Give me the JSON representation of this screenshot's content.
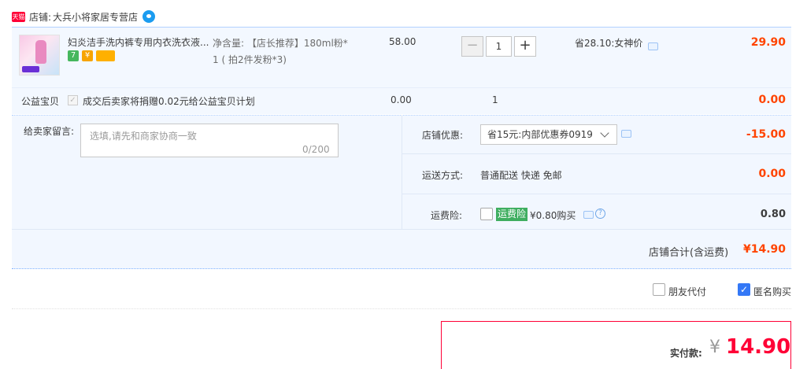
{
  "shop": {
    "badge": "天猫",
    "label": "店铺:",
    "name": "大兵小将家居专营店"
  },
  "item": {
    "title": "妇炎洁手洗内裤专用内衣洗衣液...",
    "sku_line1": "净含量: 【店长推荐】180ml粉*",
    "sku_line2": "1 ( 拍2件发粉*3)",
    "unit_price": "58.00",
    "quantity": "1",
    "minus": "−",
    "plus": "+",
    "discount": "省28.10:女神价",
    "subtotal": "29.90",
    "badges": [
      "7",
      "¥"
    ]
  },
  "charity": {
    "label": "公益宝贝",
    "text": "成交后卖家将捐赠0.02元给公益宝贝计划",
    "price": "0.00",
    "qty": "1",
    "total": "0.00"
  },
  "message": {
    "label": "给卖家留言:",
    "placeholder": "选填,请先和商家协商一致",
    "count": "0/200"
  },
  "coupon": {
    "label": "店铺优惠:",
    "value": "省15元:内部优惠券0919",
    "amount": "-15.00"
  },
  "shipping": {
    "label": "运送方式:",
    "value": "普通配送 快递 免邮",
    "amount": "0.00"
  },
  "insurance": {
    "label": "运费险:",
    "tag": "运费险",
    "price": "¥0.80购买",
    "amount": "0.80",
    "help": "?"
  },
  "shop_total": {
    "label": "店铺合计(含运费)",
    "amount": "¥14.90"
  },
  "options": {
    "friend_pay": "朋友代付",
    "anonymous": "匿名购买",
    "anonymous_checked": true
  },
  "payment": {
    "label": "实付款:",
    "yen": "¥",
    "amount": "14.90"
  },
  "colors": {
    "price_red": "#ff4400",
    "brand_red": "#ff0036",
    "panel_blue": "#f3f8ff",
    "insurance_green": "#3fae60"
  }
}
